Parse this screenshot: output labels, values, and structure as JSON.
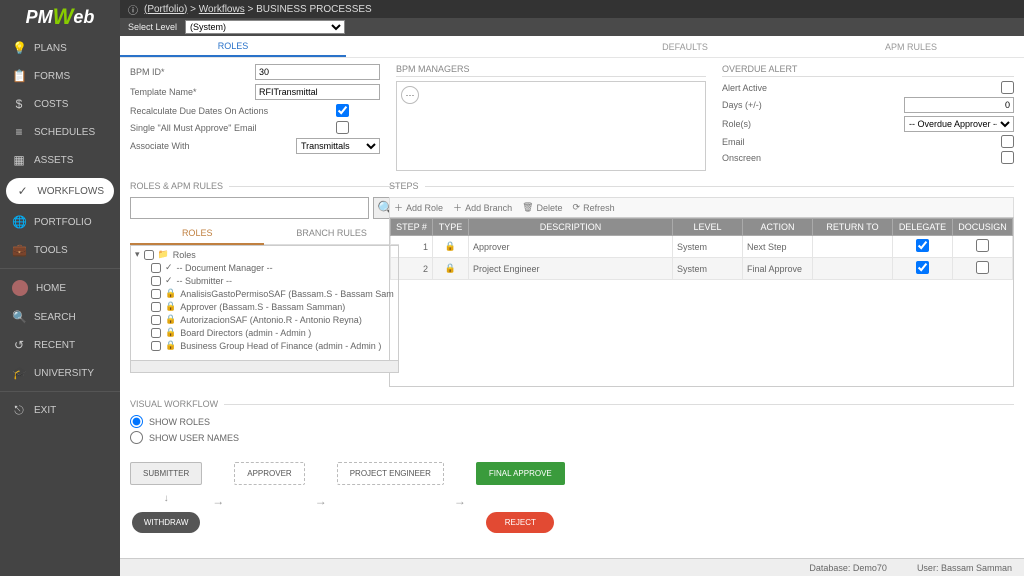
{
  "logo_prefix": "PM",
  "logo_mid": "W",
  "logo_suffix": "eb",
  "breadcrumb": {
    "portfolio": "(Portfolio)",
    "sep": ">",
    "workflows": "Workflows",
    "page": "BUSINESS PROCESSES"
  },
  "level_bar": {
    "label": "Select Level",
    "value": "(System)"
  },
  "sidebar": {
    "items": [
      {
        "icon": "💡",
        "label": "PLANS"
      },
      {
        "icon": "📋",
        "label": "FORMS"
      },
      {
        "icon": "$",
        "label": "COSTS"
      },
      {
        "icon": "≡",
        "label": "SCHEDULES"
      },
      {
        "icon": "▦",
        "label": "ASSETS"
      },
      {
        "icon": "✓",
        "label": "WORKFLOWS"
      },
      {
        "icon": "🌐",
        "label": "PORTFOLIO"
      },
      {
        "icon": "💼",
        "label": "TOOLS"
      }
    ],
    "items2": [
      {
        "icon": "",
        "label": "HOME"
      },
      {
        "icon": "🔍",
        "label": "SEARCH"
      },
      {
        "icon": "↺",
        "label": "RECENT"
      },
      {
        "icon": "🎓",
        "label": "UNIVERSITY"
      }
    ],
    "exit": {
      "icon": "⎋",
      "label": "EXIT"
    }
  },
  "tabs": [
    "ROLES",
    "",
    "DEFAULTS",
    "APM RULES"
  ],
  "form": {
    "bpm_id_label": "BPM ID*",
    "bpm_id_value": "30",
    "template_label": "Template Name*",
    "template_value": "RFITransmittal",
    "recalc_label": "Recalculate Due Dates On Actions",
    "single_label": "Single \"All Must Approve\" Email",
    "associate_label": "Associate With",
    "associate_value": "Transmittals"
  },
  "managers_label": "BPM MANAGERS",
  "overdue": {
    "title": "OVERDUE ALERT",
    "alert_label": "Alert Active",
    "days_label": "Days (+/-)",
    "days_value": "0",
    "roles_label": "Role(s)",
    "roles_value": "-- Overdue Approver --",
    "email_label": "Email",
    "onscreen_label": "Onscreen"
  },
  "roles_section": "ROLES & APM RULES",
  "steps_section": "STEPS",
  "roles_tabs": [
    "ROLES",
    "BRANCH RULES"
  ],
  "tree": {
    "root": "Roles",
    "items": [
      "-- Document Manager --",
      "-- Submitter --",
      "AnalisisGastoPermisoSAF (Bassam.S - Bassam Sam",
      "Approver (Bassam.S - Bassam Samman)",
      "AutorizacionSAF (Antonio.R - Antonio Reyna)",
      "Board Directors (admin - Admin )",
      "Business Group Head of Finance (admin - Admin )"
    ]
  },
  "toolbar": {
    "add_role": "Add Role",
    "add_branch": "Add Branch",
    "delete": "Delete",
    "refresh": "Refresh"
  },
  "steps_headers": [
    "STEP #",
    "TYPE",
    "DESCRIPTION",
    "LEVEL",
    "ACTION",
    "RETURN TO",
    "DELEGATE",
    "DOCUSIGN"
  ],
  "steps_rows": [
    {
      "n": "1",
      "desc": "Approver",
      "level": "System",
      "action": "Next Step",
      "delegate": true,
      "docusign": false
    },
    {
      "n": "2",
      "desc": "Project Engineer",
      "level": "System",
      "action": "Final Approve",
      "delegate": true,
      "docusign": false
    }
  ],
  "visual": {
    "title": "VISUAL WORKFLOW",
    "show_roles": "SHOW ROLES",
    "show_users": "SHOW USER NAMES",
    "nodes": {
      "submitter": "SUBMITTER",
      "approver": "APPROVER",
      "engineer": "PROJECT ENGINEER",
      "final": "FINAL APPROVE",
      "withdraw": "WITHDRAW",
      "reject": "REJECT"
    }
  },
  "footer": {
    "db_label": "Database:",
    "db_val": "Demo70",
    "user_label": "User:",
    "user_val": "Bassam Samman"
  }
}
